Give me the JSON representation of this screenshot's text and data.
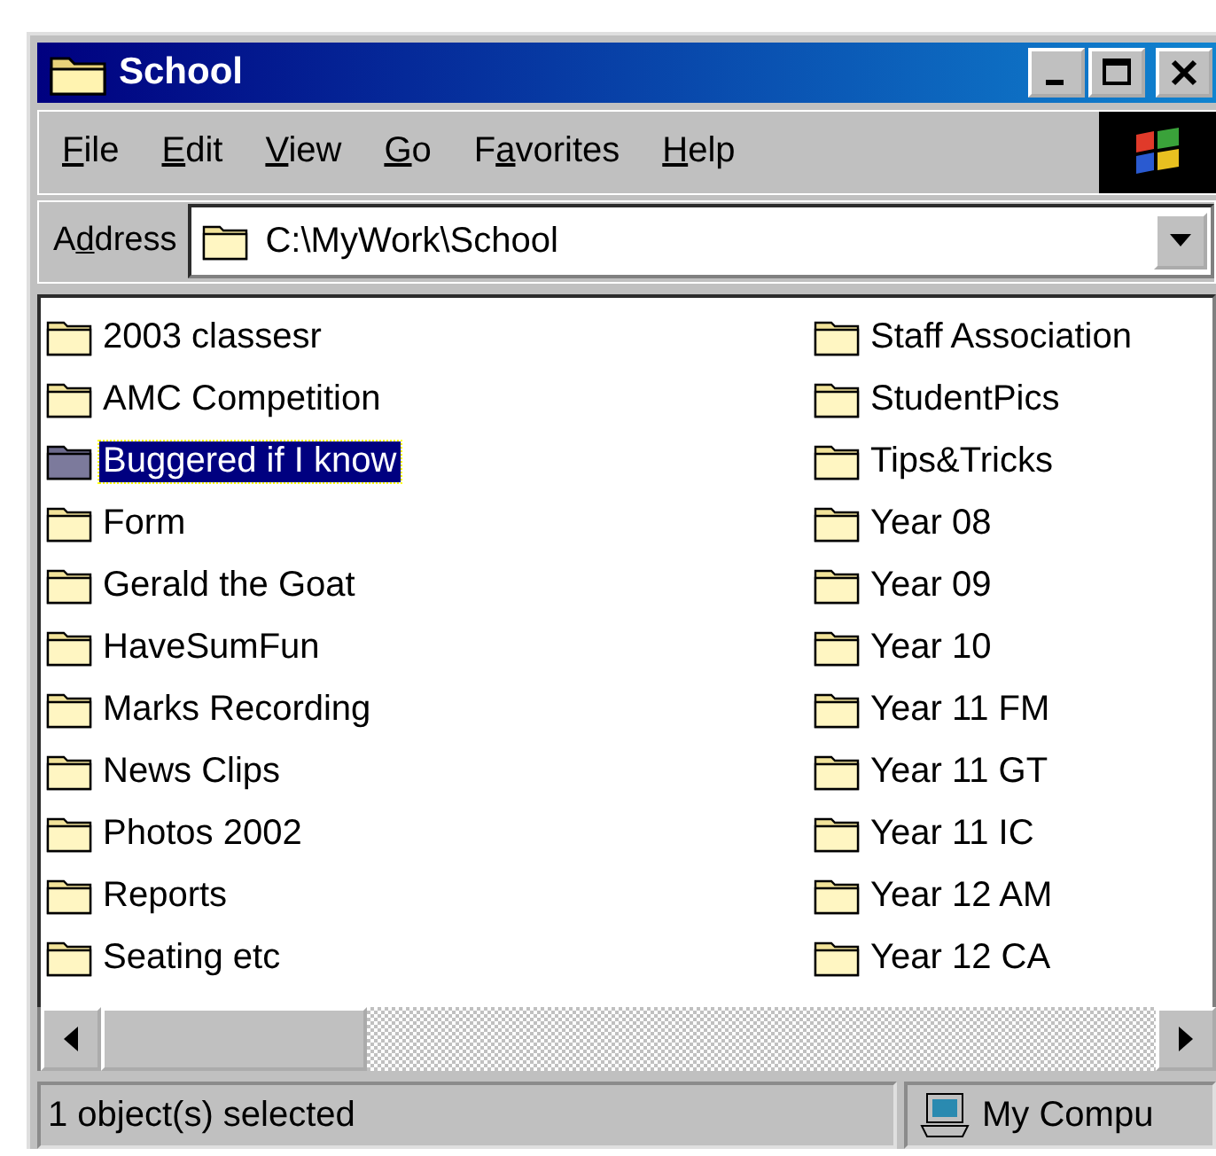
{
  "window": {
    "title": "School"
  },
  "menu": [
    {
      "key": "F",
      "after": "ile"
    },
    {
      "key": "E",
      "after": "dit"
    },
    {
      "key": "V",
      "after": "iew"
    },
    {
      "key": "G",
      "after": "o"
    },
    {
      "before": "F",
      "key": "a",
      "after": "vorites"
    },
    {
      "key": "H",
      "after": "elp"
    }
  ],
  "address": {
    "label": {
      "before": "A",
      "key": "d",
      "after": "dress"
    },
    "value": "C:\\MyWork\\School"
  },
  "items": [
    {
      "name": "2003 classesr",
      "selected": false
    },
    {
      "name": "AMC Competition",
      "selected": false
    },
    {
      "name": "Buggered if I know",
      "selected": true
    },
    {
      "name": "Form",
      "selected": false
    },
    {
      "name": "Gerald the Goat",
      "selected": false
    },
    {
      "name": "HaveSumFun",
      "selected": false
    },
    {
      "name": "Marks Recording",
      "selected": false
    },
    {
      "name": "News Clips",
      "selected": false
    },
    {
      "name": "Photos 2002",
      "selected": false
    },
    {
      "name": "Reports",
      "selected": false
    },
    {
      "name": "Seating etc",
      "selected": false
    },
    {
      "name": "Staff Association",
      "selected": false
    },
    {
      "name": "StudentPics",
      "selected": false
    },
    {
      "name": "Tips&Tricks",
      "selected": false
    },
    {
      "name": "Year 08",
      "selected": false
    },
    {
      "name": "Year 09",
      "selected": false
    },
    {
      "name": "Year 10",
      "selected": false
    },
    {
      "name": "Year 11 FM",
      "selected": false
    },
    {
      "name": "Year 11 GT",
      "selected": false
    },
    {
      "name": "Year 11 IC",
      "selected": false
    },
    {
      "name": "Year 12 AM",
      "selected": false
    },
    {
      "name": "Year 12 CA",
      "selected": false
    }
  ],
  "status_bar": {
    "message": "1 object(s) selected",
    "zone": "My Compu"
  }
}
